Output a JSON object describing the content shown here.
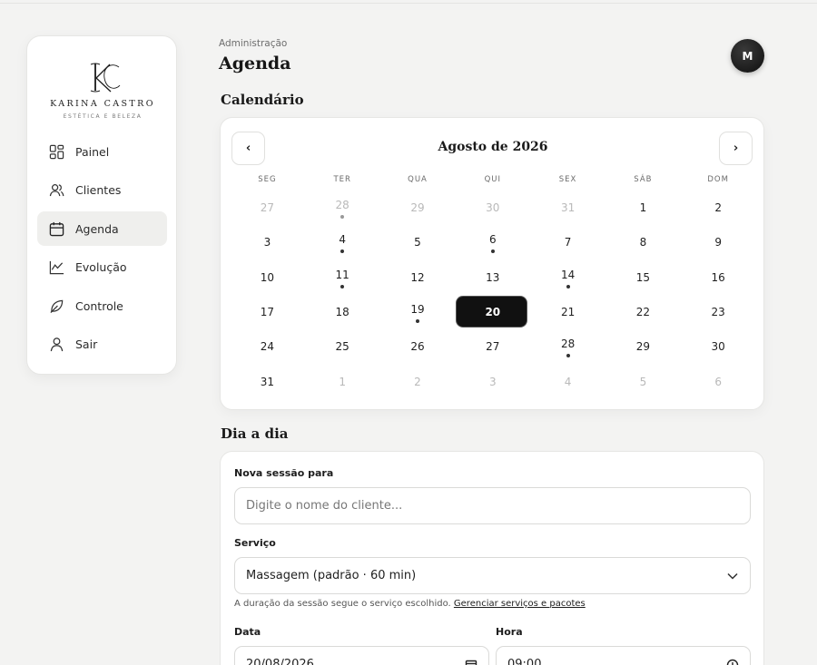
{
  "brand": {
    "name": "KARINA CASTRO",
    "tagline": "ESTÉTICA E BELEZA"
  },
  "sidebar": {
    "items": [
      {
        "label": "Painel",
        "icon": "dashboard-icon"
      },
      {
        "label": "Clientes",
        "icon": "users-icon"
      },
      {
        "label": "Agenda",
        "icon": "calendar-icon",
        "active": true
      },
      {
        "label": "Evolução",
        "icon": "chart-line-icon"
      },
      {
        "label": "Controle",
        "icon": "leaf-icon"
      },
      {
        "label": "Sair",
        "icon": "user-icon"
      }
    ]
  },
  "header": {
    "breadcrumb": "Administração",
    "title": "Agenda",
    "avatar_initial": "M"
  },
  "calendar": {
    "section_title": "Calendário",
    "month_label": "Agosto de 2026",
    "prev_label": "‹",
    "next_label": "›",
    "weekdays": [
      "SEG",
      "TER",
      "QUA",
      "QUI",
      "SEX",
      "SÁB",
      "DOM"
    ],
    "weeks": [
      [
        "27",
        "28",
        "29",
        "30",
        "31",
        "1",
        "2"
      ],
      [
        "3",
        "4",
        "5",
        "6",
        "7",
        "8",
        "9"
      ],
      [
        "10",
        "11",
        "12",
        "13",
        "14",
        "15",
        "16"
      ],
      [
        "17",
        "18",
        "19",
        "20",
        "21",
        "22",
        "23"
      ],
      [
        "24",
        "25",
        "26",
        "27",
        "28",
        "29",
        "30"
      ],
      [
        "31",
        "1",
        "2",
        "3",
        "4",
        "5",
        "6"
      ]
    ],
    "selected_day": "20"
  },
  "daily": {
    "section_title": "Dia a dia",
    "client_label": "Nova sessão para",
    "client_placeholder": "Digite o nome do cliente...",
    "service_label": "Serviço",
    "service_value": "Massagem (padrão · 60 min)",
    "hint_text": "A duração da sessão segue o serviço escolhido.",
    "hint_link": "Gerenciar serviços e pacotes",
    "date_label": "Data",
    "date_value": "20/08/2026",
    "time_label": "Hora",
    "time_value": "09:00"
  }
}
